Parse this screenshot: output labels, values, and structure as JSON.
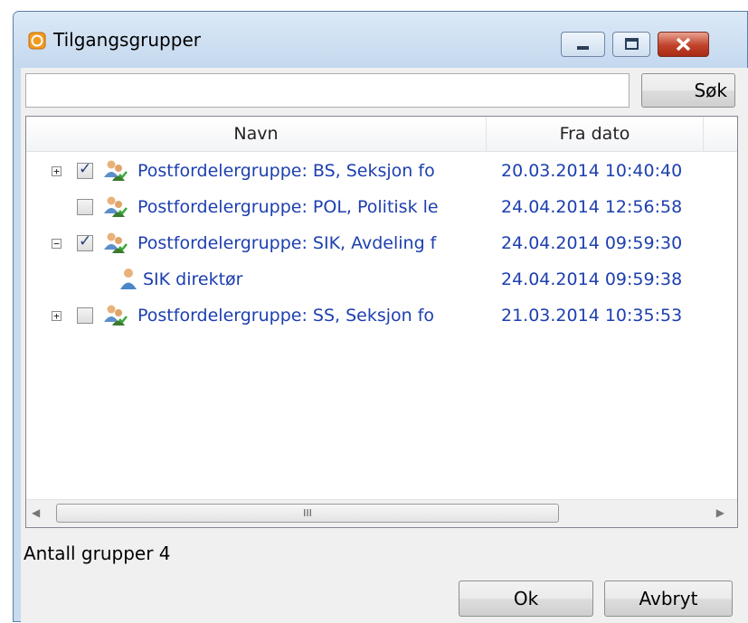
{
  "window": {
    "title": "Tilgangsgrupper"
  },
  "search": {
    "value": "",
    "button_label": "Søk"
  },
  "columns": {
    "name": "Navn",
    "date": "Fra dato"
  },
  "rows": [
    {
      "expander": "+",
      "checked": true,
      "name": "Postfordelergruppe: BS, Seksjon fo",
      "date": "20.03.2014 10:40:40",
      "icon": "group-icon"
    },
    {
      "expander": "",
      "checked": false,
      "name": "Postfordelergruppe: POL, Politisk le",
      "date": "24.04.2014 12:56:58",
      "icon": "group-icon"
    },
    {
      "expander": "−",
      "checked": true,
      "name": "Postfordelergruppe: SIK, Avdeling f",
      "date": "24.04.2014 09:59:30",
      "icon": "group-icon"
    },
    {
      "expander": "",
      "checked": null,
      "name": "SIK direktør",
      "date": "24.04.2014 09:59:38",
      "icon": "user-icon"
    },
    {
      "expander": "+",
      "checked": false,
      "name": "Postfordelergruppe: SS, Seksjon fo",
      "date": "21.03.2014 10:35:53",
      "icon": "group-icon"
    }
  ],
  "scrollbar": {
    "grip": "III"
  },
  "footer": {
    "count_text": "Antall grupper 4",
    "ok_label": "Ok",
    "cancel_label": "Avbryt"
  }
}
